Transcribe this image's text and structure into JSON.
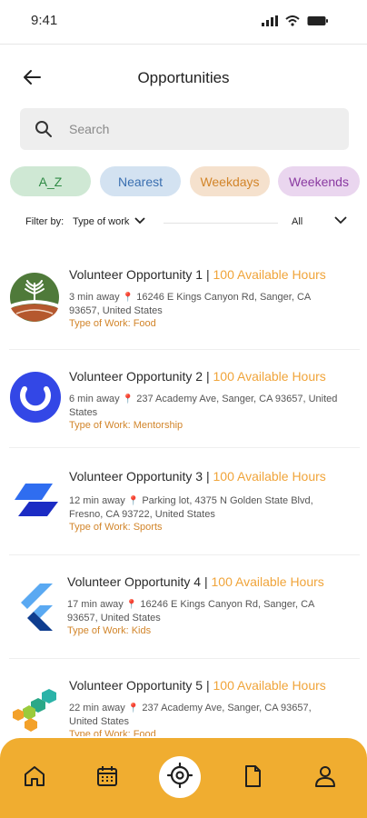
{
  "status_bar": {
    "time": "9:41",
    "icons": [
      "signal-icon",
      "wifi-icon",
      "battery-icon"
    ]
  },
  "header": {
    "title": "Opportunities",
    "back_icon": "arrow-left-icon"
  },
  "search": {
    "placeholder": "Search",
    "value": ""
  },
  "chips": [
    {
      "label": "A_Z",
      "color": "#2e8a44",
      "bg": "#cfe8d4"
    },
    {
      "label": "Nearest",
      "color": "#3a6fb0",
      "bg": "#d3e2f1"
    },
    {
      "label": "Weekdays",
      "color": "#d2852a",
      "bg": "#f5e1cd"
    },
    {
      "label": "Weekends",
      "color": "#8a3aa1",
      "bg": "#ead6ef"
    }
  ],
  "filter": {
    "label": "Filter by:",
    "type_label": "Type of work",
    "value": "All"
  },
  "opportunities": [
    {
      "title": "Volunteer Opportunity 1 | ",
      "hours": "100 Available Hours",
      "distance": "3 min away",
      "address": "16246 E Kings Canyon Rd, Sanger, CA 93657, United States",
      "type": "Type of Work: Food",
      "logo": "farm-logo"
    },
    {
      "title": "Volunteer Opportunity 2 | ",
      "hours": "100 Available Hours",
      "distance": "6 min away",
      "address": "237 Academy Ave, Sanger, CA 93657, United States",
      "type": "Type of Work: Mentorship",
      "logo": "ring-logo"
    },
    {
      "title": "Volunteer Opportunity 3 | ",
      "hours": "100 Available Hours",
      "distance": "12 min away",
      "address": "Parking lot, 4375 N Golden State Blvd, Fresno, CA 93722, United States",
      "type": "Type of Work: Sports",
      "logo": "parallelogram-logo"
    },
    {
      "title": "Volunteer Opportunity 4 | ",
      "hours": "100 Available Hours",
      "distance": "17 min away",
      "address": "16246 E Kings Canyon Rd, Sanger, CA 93657, United States",
      "type": "Type of Work: Kids",
      "logo": "chevron-logo"
    },
    {
      "title": "Volunteer Opportunity 5 | ",
      "hours": "100 Available Hours",
      "distance": "22 min away",
      "address": "237 Academy Ave, Sanger, CA 93657, United States",
      "type": "Type of Work: Food",
      "logo": "hexagon-logo"
    }
  ],
  "bottom_nav": {
    "items": [
      "home-icon",
      "calendar-icon",
      "target-icon",
      "document-icon",
      "profile-icon"
    ],
    "active": "target-icon",
    "accent": "#f0ad30"
  }
}
